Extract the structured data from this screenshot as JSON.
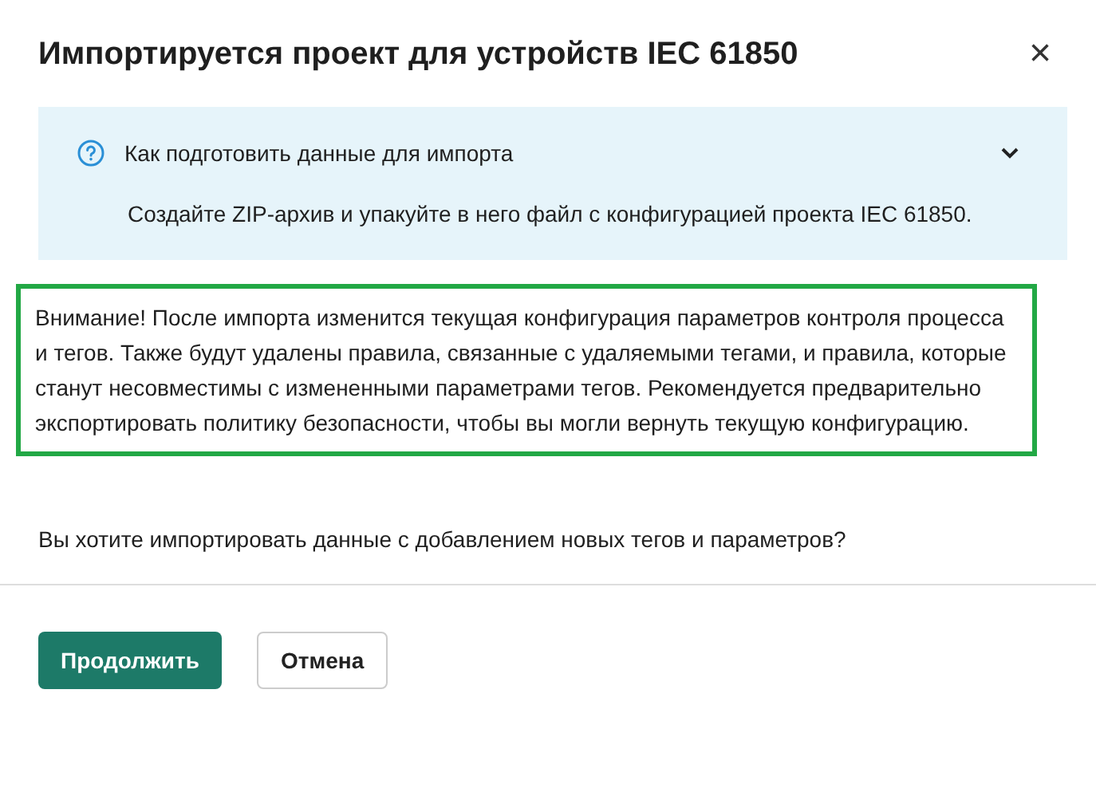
{
  "dialog": {
    "title": "Импортируется проект для устройств IEC 61850",
    "close": "×"
  },
  "info": {
    "title": "Как подготовить данные для импорта",
    "expanded": true,
    "body": "Создайте ZIP-архив и упакуйте в него файл с конфигурацией проекта IEC 61850."
  },
  "warning": {
    "text": "Внимание! После импорта изменится текущая конфигурация параметров контроля процесса и тегов. Также будут удалены правила, связанные с удаляемыми тегами, и правила, которые станут несовместимы с измененными параметрами тегов. Рекомендуется предварительно экспортировать политику безопасности, чтобы вы могли вернуть текущую конфигурацию."
  },
  "question": "Вы хотите импортировать данные с добавлением новых тегов и параметров?",
  "buttons": [
    {
      "label": "Продолжить",
      "kind": "primary"
    },
    {
      "label": "Отмена",
      "kind": "secondary"
    }
  ]
}
